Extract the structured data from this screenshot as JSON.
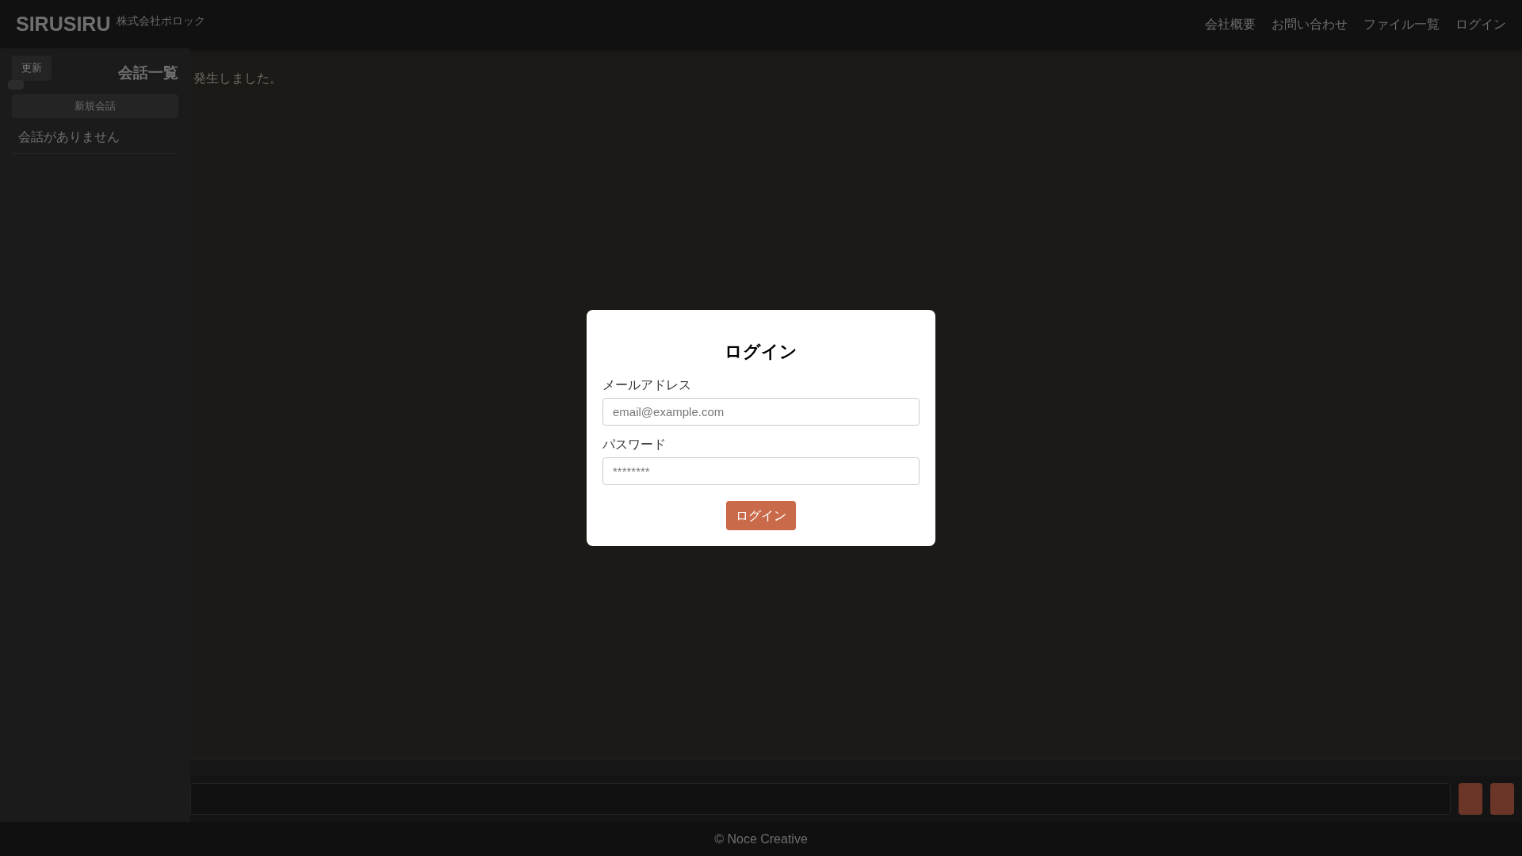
{
  "header": {
    "logo": "SIRUSIRU",
    "company": "株式会社ポロック",
    "nav": [
      "会社概要",
      "お問い合わせ",
      "ファイル一覧",
      "ログイン"
    ]
  },
  "sidebar": {
    "refresh_button": "更新",
    "title": "会話一覧",
    "new_button": "新規会話",
    "empty_message": "会話がありません"
  },
  "main": {
    "message": "発生しました。"
  },
  "login_dialog": {
    "title": "ログイン",
    "fields": [
      {
        "label": "メールアドレス",
        "placeholder": "email@example.com"
      },
      {
        "label": "パスワード",
        "placeholder": "********"
      }
    ],
    "submit": "ログイン"
  },
  "footer": {
    "text": "© Noce Creative"
  }
}
